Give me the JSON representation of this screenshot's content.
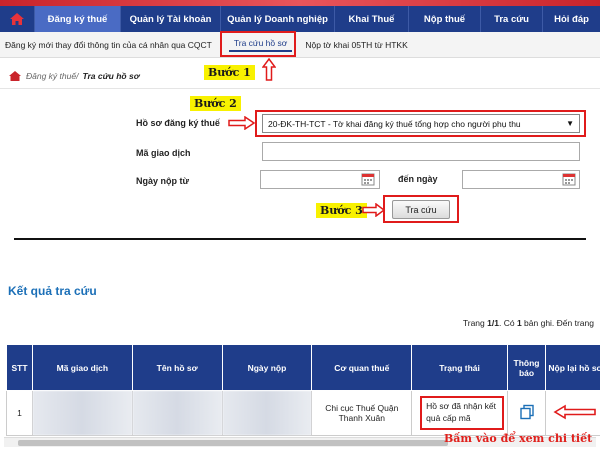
{
  "nav": {
    "items": [
      "Đăng ký thuế",
      "Quản lý Tài khoản",
      "Quản lý Doanh nghiệp",
      "Khai Thuế",
      "Nộp thuế",
      "Tra cứu",
      "Hỏi đáp"
    ]
  },
  "subnav": {
    "items": [
      "Đăng ký mới thay đổi thông tin của cá nhân qua CQCT",
      "Tra cứu hồ sơ",
      "Nộp tờ khai 05TH từ HTKK"
    ]
  },
  "breadcrumb": {
    "parent": "Đăng ký thuế/",
    "current": "Tra cứu hồ sơ"
  },
  "steps": {
    "s1": "Bước 1",
    "s2": "Bước 2",
    "s3": "Bước 3"
  },
  "form": {
    "ho_so_label": "Hồ sơ đăng ký thuế",
    "ho_so_value": "20-ĐK-TH-TCT - Tờ khai đăng ký thuế tổng hợp cho người phụ thu",
    "ma_gd_label": "Mã giao dịch",
    "ma_gd_value": "",
    "ngay_nop_label": "Ngày nộp từ",
    "den_ngay_label": "đến ngày",
    "ngay_tu_value": "",
    "den_ngay_value": "",
    "search_button": "Tra cứu"
  },
  "results": {
    "title": "Kết quả tra cứu",
    "pagination": {
      "page_label": "Trang",
      "page": "1/1",
      "count_prefix": "Có",
      "count": "1",
      "count_suffix": "bản ghi. Đến trang"
    },
    "columns": [
      "STT",
      "Mã giao dịch",
      "Tên hồ sơ",
      "Ngày nộp",
      "Cơ quan thuế",
      "Trạng thái",
      "Thông báo",
      "Nộp lại hồ sơ"
    ],
    "rows": [
      {
        "stt": "1",
        "ma_gd": "",
        "ten_ho_so": "",
        "ngay_nop": "",
        "co_quan": "Chi cục Thuế Quận Thanh Xuân",
        "trang_thai": "Hồ sơ đã nhận kết quả cấp mã"
      }
    ]
  },
  "hint": "Bấm vào để xem chi tiết",
  "colors": {
    "nav_bg": "#1f3d8a",
    "accent_red": "#e01b1b",
    "step_bg": "#f8f100",
    "title_blue": "#1b6fb7"
  },
  "icons": [
    "home-icon",
    "calendar-icon",
    "document-copy-icon",
    "arrow-icon"
  ]
}
